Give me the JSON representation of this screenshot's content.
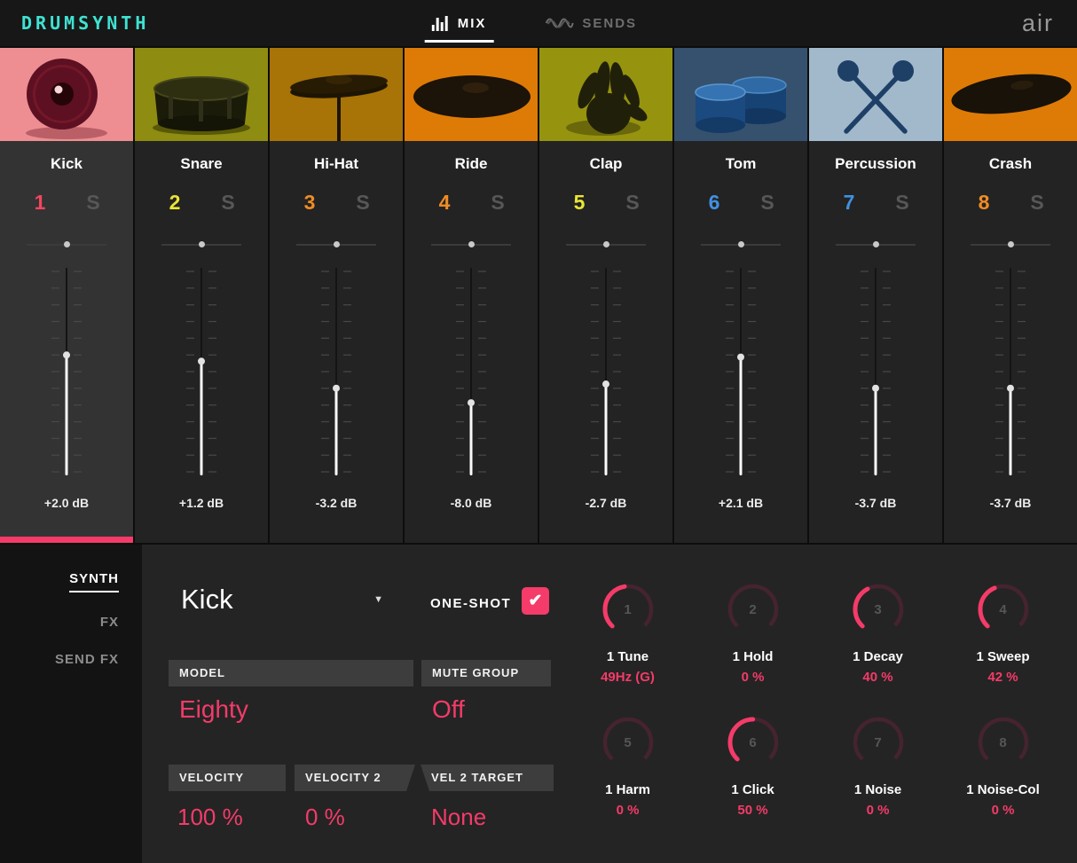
{
  "colors": {
    "accent": "#f43b69",
    "logo_teal": "#3fe2d2"
  },
  "icons": {
    "check": "✔",
    "dropdown_arrow": "▼"
  },
  "header": {
    "logo": "DRUMSYNTH",
    "tabs": [
      {
        "label": "MIX",
        "active": true
      },
      {
        "label": "SENDS",
        "active": false
      }
    ],
    "brand": "air"
  },
  "channels": [
    {
      "name": "Kick",
      "number": "1",
      "number_color": "#f4455f",
      "solo": "S",
      "pan_pct": 50,
      "fader_pct": 58,
      "db": "+2.0 dB",
      "selected": true,
      "thumb": "kick",
      "thumb_bg": "#ee8e92"
    },
    {
      "name": "Snare",
      "number": "2",
      "number_color": "#e9e535",
      "solo": "S",
      "pan_pct": 50,
      "fader_pct": 55,
      "db": "+1.2 dB",
      "selected": false,
      "thumb": "snare",
      "thumb_bg": "#8e8c11"
    },
    {
      "name": "Hi-Hat",
      "number": "3",
      "number_color": "#f08c24",
      "solo": "S",
      "pan_pct": 50,
      "fader_pct": 42,
      "db": "-3.2 dB",
      "selected": false,
      "thumb": "hihat",
      "thumb_bg": "#a87307"
    },
    {
      "name": "Ride",
      "number": "4",
      "number_color": "#f08c24",
      "solo": "S",
      "pan_pct": 50,
      "fader_pct": 35,
      "db": "-8.0 dB",
      "selected": false,
      "thumb": "ride",
      "thumb_bg": "#de7b06"
    },
    {
      "name": "Clap",
      "number": "5",
      "number_color": "#e9e535",
      "solo": "S",
      "pan_pct": 50,
      "fader_pct": 44,
      "db": "-2.7 dB",
      "selected": false,
      "thumb": "clap",
      "thumb_bg": "#96930f"
    },
    {
      "name": "Tom",
      "number": "6",
      "number_color": "#4191e0",
      "solo": "S",
      "pan_pct": 50,
      "fader_pct": 57,
      "db": "+2.1 dB",
      "selected": false,
      "thumb": "tom",
      "thumb_bg": "#36516e"
    },
    {
      "name": "Percussion",
      "number": "7",
      "number_color": "#4191e0",
      "solo": "S",
      "pan_pct": 50,
      "fader_pct": 42,
      "db": "-3.7 dB",
      "selected": false,
      "thumb": "percussion",
      "thumb_bg": "#a2b9cb"
    },
    {
      "name": "Crash",
      "number": "8",
      "number_color": "#f08c24",
      "solo": "S",
      "pan_pct": 50,
      "fader_pct": 42,
      "db": "-3.7 dB",
      "selected": false,
      "thumb": "crash",
      "thumb_bg": "#de7b06"
    }
  ],
  "sidebar": {
    "items": [
      {
        "label": "SYNTH",
        "active": true
      },
      {
        "label": "FX",
        "active": false
      },
      {
        "label": "SEND FX",
        "active": false
      }
    ]
  },
  "panel": {
    "preset": "Kick",
    "one_shot": {
      "label": "ONE-SHOT",
      "checked": true
    },
    "fields": {
      "model": {
        "label": "MODEL",
        "value": "Eighty"
      },
      "mute_group": {
        "label": "MUTE GROUP",
        "value": "Off"
      },
      "velocity": {
        "label": "VELOCITY",
        "value": "100 %"
      },
      "velocity2": {
        "label": "VELOCITY 2",
        "value": "0 %"
      },
      "vel2_target": {
        "label": "VEL 2 TARGET",
        "value": "None"
      }
    },
    "knobs": [
      {
        "num": "1",
        "label": "1 Tune",
        "value": "49Hz (G)",
        "arc_pct": 47
      },
      {
        "num": "2",
        "label": "1 Hold",
        "value": "0 %",
        "arc_pct": 0
      },
      {
        "num": "3",
        "label": "1 Decay",
        "value": "40 %",
        "arc_pct": 40
      },
      {
        "num": "4",
        "label": "1 Sweep",
        "value": "42 %",
        "arc_pct": 42
      },
      {
        "num": "5",
        "label": "1 Harm",
        "value": "0 %",
        "arc_pct": 0
      },
      {
        "num": "6",
        "label": "1 Click",
        "value": "50 %",
        "arc_pct": 50
      },
      {
        "num": "7",
        "label": "1 Noise",
        "value": "0 %",
        "arc_pct": 0
      },
      {
        "num": "8",
        "label": "1 Noise-Col",
        "value": "0 %",
        "arc_pct": 0
      }
    ]
  }
}
